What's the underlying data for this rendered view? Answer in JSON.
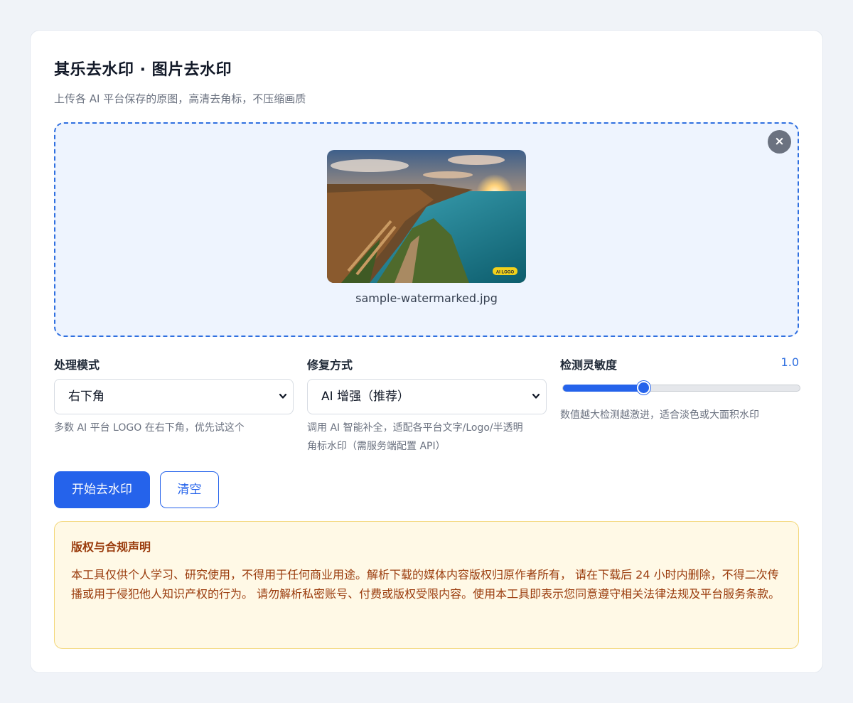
{
  "header": {
    "title": "其乐去水印 · 图片去水印",
    "subtitle": "上传各 AI 平台保存的原图，高清去角标，不压缩画质"
  },
  "upload": {
    "filename": "sample-watermarked.jpg",
    "close_label": "×",
    "preview_badge": "AI LOGO"
  },
  "mode": {
    "label": "处理模式",
    "selected": "右下角",
    "hint": "多数 AI 平台 LOGO 在右下角，优先试这个"
  },
  "repair": {
    "label": "修复方式",
    "selected": "AI 增强（推荐）",
    "hint_line1": "调用 AI 智能补全，适配各平台文字/Logo/半透明",
    "hint_line2": "角标水印（需服务端配置 API）"
  },
  "sensitivity": {
    "label": "检测灵敏度",
    "value_text": "1.0",
    "level_fraction": 0.34,
    "hint": "数值越大检测越激进，适合淡色或大面积水印"
  },
  "actions": {
    "start_label": "开始去水印",
    "clear_label": "清空"
  },
  "notice": {
    "title": "版权与合规声明",
    "body": "本工具仅供个人学习、研究使用，不得用于任何商业用途。解析下载的媒体内容版权归原作者所有， 请在下载后 24 小时内删除，不得二次传播或用于侵犯他人知识产权的行为。 请勿解析私密账号、付费或版权受限内容。使用本工具即表示您同意遵守相关法律法规及平台服务条款。"
  },
  "colors": {
    "accent": "#2563eb",
    "dropzone_bg": "#eef4fe",
    "notice_bg": "#fff9e6",
    "notice_text": "#9a3b0c"
  }
}
